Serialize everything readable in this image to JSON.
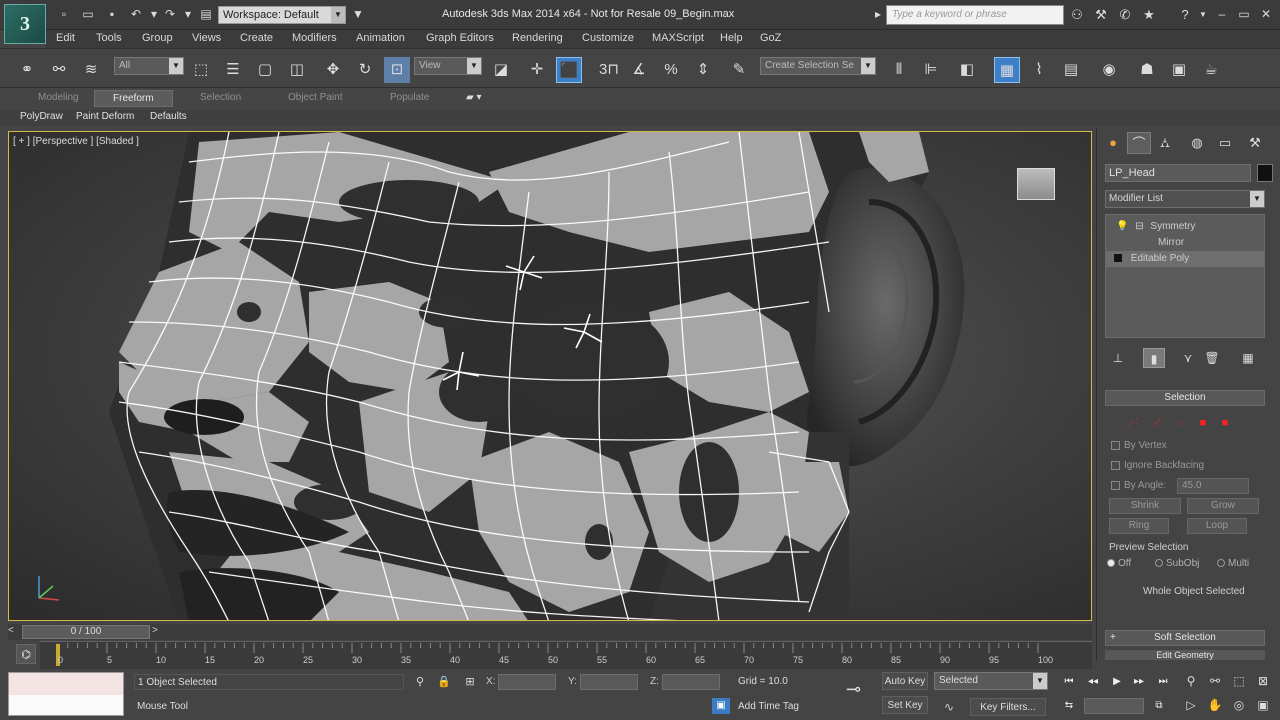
{
  "titlebar": {
    "workspace_label": "Workspace: Default",
    "window_title": "Autodesk 3ds Max  2014 x64    - Not for Resale   09_Begin.max",
    "search_placeholder": "Type a keyword or phrase"
  },
  "menu": [
    "Edit",
    "Tools",
    "Group",
    "Views",
    "Create",
    "Modifiers",
    "Animation",
    "Graph Editors",
    "Rendering",
    "Customize",
    "MAXScript",
    "Help",
    "GoZ"
  ],
  "toolbar": {
    "filter_value": "All",
    "refcoord_value": "View",
    "selection_set_placeholder": "Create Selection Se",
    "snap_label": "3"
  },
  "ribbon": {
    "tabs": [
      "Modeling",
      "Freeform",
      "Selection",
      "Object Paint",
      "Populate"
    ],
    "subtabs": [
      "PolyDraw",
      "Paint Deform",
      "Defaults"
    ]
  },
  "viewport": {
    "label": "[ + ] [Perspective ] [Shaded ]"
  },
  "command_panel": {
    "object_name": "LP_Head",
    "modifier_list_label": "Modifier List",
    "stack": [
      {
        "label": "Symmetry",
        "indent": 1
      },
      {
        "label": "Mirror",
        "indent": 2
      },
      {
        "label": "Editable Poly",
        "indent": 0
      }
    ],
    "selection_title": "Selection",
    "checkboxes": [
      "By Vertex",
      "Ignore Backfacing",
      "By Angle:"
    ],
    "angle_value": "45.0",
    "buttons": [
      "Shrink",
      "Grow",
      "Ring",
      "Loop"
    ],
    "preview_label": "Preview Selection",
    "preview_options": [
      "Off",
      "SubObj",
      "Multi"
    ],
    "whole_object": "Whole Object Selected",
    "soft_selection": "Soft Selection",
    "edit_geometry": "Edit Geometry"
  },
  "timeline": {
    "slider_label": "0 / 100",
    "ticks": [
      "0",
      "5",
      "10",
      "15",
      "20",
      "25",
      "30",
      "35",
      "40",
      "45",
      "50",
      "55",
      "60",
      "65",
      "70",
      "75",
      "80",
      "85",
      "90",
      "95",
      "100"
    ]
  },
  "status": {
    "selection": "1 Object Selected",
    "prompt": "Mouse Tool",
    "grid": "Grid = 10.0",
    "add_time_tag": "Add Time Tag",
    "auto_key": "Auto Key",
    "set_key": "Set Key",
    "selected_value": "Selected",
    "key_filters": "Key Filters...",
    "x_label": "X:",
    "y_label": "Y:",
    "z_label": "Z:"
  },
  "colors": {
    "viewport_border": "#d7b94a",
    "active_tool": "#3e80c8",
    "red_selection": "#d23030",
    "wire": "#ffffff",
    "clay": "#a6a6a6"
  }
}
